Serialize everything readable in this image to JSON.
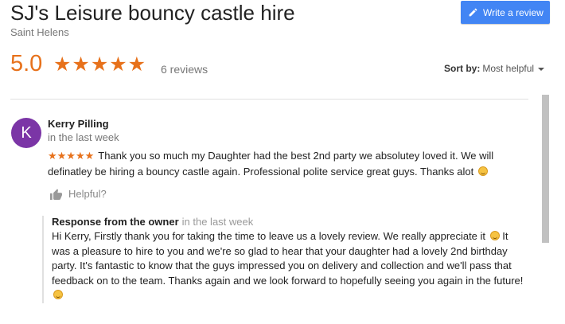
{
  "business": {
    "name": "SJ's Leisure bouncy castle hire",
    "location": "Saint Helens"
  },
  "write_review_button": {
    "label": "Write a review",
    "color": "#4285f4"
  },
  "rating": {
    "score": "5.0",
    "stars": "★★★★★",
    "review_count": "6 reviews",
    "star_color": "#e7711b"
  },
  "sort": {
    "label": "Sort by:",
    "value": "Most helpful"
  },
  "review": {
    "avatar_letter": "K",
    "avatar_color": "#7b35a6",
    "author": "Kerry Pilling",
    "time": "in the last week",
    "stars": "★★★★★",
    "text": "Thank you so much my Daughter had the best 2nd party we absolutey loved it. We will definatley be hiring a bouncy castle again. Professional polite service great guys. Thanks alot",
    "helpful_label": "Helpful?"
  },
  "owner_response": {
    "heading": "Response from the owner",
    "time": "in the last week",
    "text_part1": "Hi Kerry, Firstly thank you for taking the time to leave us a lovely review. We really appreciate it",
    "text_part2": "It was a pleasure to hire to you and we're so glad to hear that your daughter had a lovely 2nd birthday party. It's fantastic to know that the guys impressed you on delivery and collection and we'll pass that feedback on to the team. Thanks again and we look forward to hopefully seeing you again in the future!"
  }
}
